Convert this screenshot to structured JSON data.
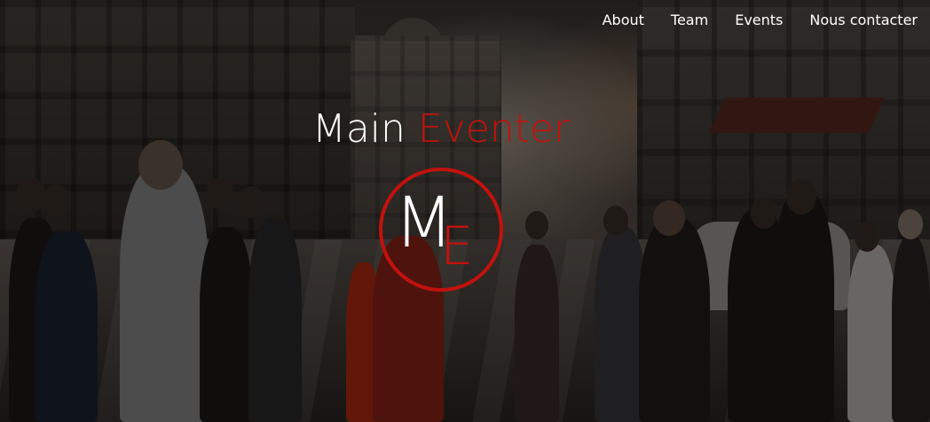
{
  "nav": {
    "items": [
      {
        "label": "About"
      },
      {
        "label": "Team"
      },
      {
        "label": "Events"
      },
      {
        "label": "Nous contacter"
      }
    ]
  },
  "hero": {
    "title_part1": "Main",
    "title_part2": "Eventer",
    "logo_letter_1": "M",
    "logo_letter_2": "E"
  },
  "colors": {
    "accent": "#c2120e",
    "text": "#ffffff"
  }
}
